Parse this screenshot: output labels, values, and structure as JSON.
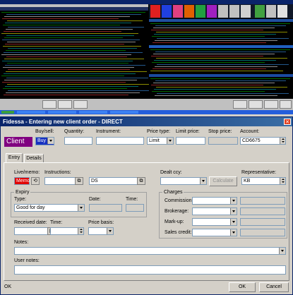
{
  "dialog": {
    "title": "Fidessa - Entering new client order - DIRECT",
    "close_glyph": "✕",
    "client_label": "Client",
    "buy_sell_label": "Buy/sell:",
    "buy_sell_value": "Buy",
    "quantity_label": "Quantity:",
    "quantity_value": "",
    "instrument_label": "Instrument:",
    "instrument_value": "",
    "price_type_label": "Price type:",
    "price_type_value": "Limit",
    "limit_price_label": "Limit price:",
    "limit_price_value": "",
    "stop_price_label": "Stop price:",
    "stop_price_value": "",
    "account_label": "Account:",
    "account_value": "CD6675",
    "tabs": [
      {
        "label": "Entry"
      },
      {
        "label": "Details"
      }
    ],
    "live_memo_label": "Live/memo:",
    "live_memo_value": "Memo",
    "instructions_label": "Instructions:",
    "instructions_value": "",
    "ds_value": "DS",
    "dealt_ccy_label": "Dealt ccy:",
    "dealt_ccy_value": "",
    "calculate_label": "Calculate",
    "representative_label": "Representative:",
    "representative_value": "KB",
    "expiry": {
      "title": "Expiry",
      "type_label": "Type:",
      "type_value": "Good for day",
      "date_label": "Date:",
      "time_label": "Time:"
    },
    "charges": {
      "title": "Charges",
      "commission_label": "Commission:",
      "brokerage_label": "Brokerage:",
      "markup_label": "Mark-up:",
      "sales_credit_label": "Sales credit:"
    },
    "received_date_label": "Received date:",
    "received_time_label": "Time:",
    "price_basis_label": "Price basis:",
    "notes_label": "Notes:",
    "user_notes_label": "User notes:",
    "status_text": "OK",
    "ok_label": "OK",
    "cancel_label": "Cancel"
  },
  "colors": {
    "client_bg": "#800080",
    "buy_bg": "#1530c0",
    "memo_bg": "#e00000",
    "title_bar": "#0a246a"
  },
  "icons": {
    "undo": "undo-icon",
    "lookup": "lookup-icon",
    "calendar": "calendar-icon"
  }
}
